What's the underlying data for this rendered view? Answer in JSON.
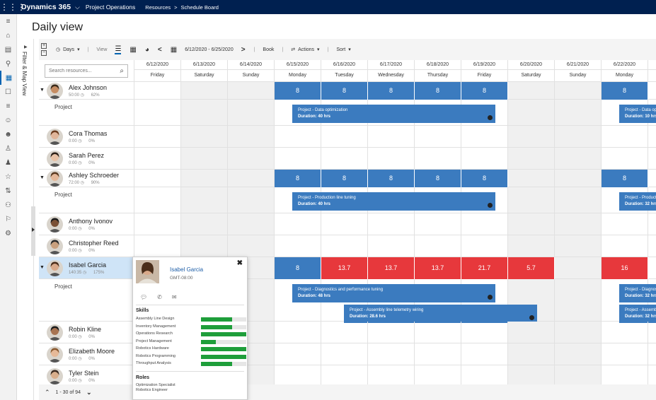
{
  "topbar": {
    "app_name": "Dynamics 365",
    "module": "Project Operations",
    "crumb1": "Resources",
    "crumb2": "Schedule Board"
  },
  "nav_icons": [
    "home-icon",
    "recent-icon",
    "pinned-icon",
    "calendar-icon",
    "chat-icon",
    "list-icon",
    "people-icon",
    "group-icon",
    "person-add-icon",
    "person-icon",
    "star-icon",
    "sort-icon",
    "team-icon",
    "flag-icon",
    "settings-icon"
  ],
  "page": {
    "title": "Daily view"
  },
  "filter": {
    "label": "Filter & Map View"
  },
  "toolbar": {
    "days_label": "Days",
    "view_label": "View",
    "date_range": "6/12/2020 - 6/25/2020",
    "book_label": "Book",
    "actions_label": "Actions",
    "sort_label": "Sort"
  },
  "search": {
    "placeholder": "Search resources..."
  },
  "dates": [
    {
      "date": "6/12/2020",
      "day": "Friday",
      "weekend": false
    },
    {
      "date": "6/13/2020",
      "day": "Saturday",
      "weekend": true
    },
    {
      "date": "6/14/2020",
      "day": "Sunday",
      "weekend": true
    },
    {
      "date": "6/15/2020",
      "day": "Monday",
      "weekend": false
    },
    {
      "date": "6/16/2020",
      "day": "Tuesday",
      "weekend": false
    },
    {
      "date": "6/17/2020",
      "day": "Wednesday",
      "weekend": false
    },
    {
      "date": "6/18/2020",
      "day": "Thursday",
      "weekend": false
    },
    {
      "date": "6/19/2020",
      "day": "Friday",
      "weekend": false
    },
    {
      "date": "6/20/2020",
      "day": "Saturday",
      "weekend": true
    },
    {
      "date": "6/21/2020",
      "day": "Sunday",
      "weekend": true
    },
    {
      "date": "6/22/2020",
      "day": "Monday",
      "weekend": false
    },
    {
      "date": "",
      "day": "",
      "weekend": false
    }
  ],
  "resources": [
    {
      "name": "Alex Johnson",
      "hours": "50:00",
      "pct": "62%",
      "expanded": true,
      "selected": false,
      "skin": "#c58c62",
      "hair": "#3a2a1a",
      "project_label": "Project",
      "capacity": [
        null,
        null,
        null,
        {
          "v": "8",
          "c": "blue"
        },
        {
          "v": "8",
          "c": "blue"
        },
        {
          "v": "8",
          "c": "blue"
        },
        {
          "v": "8",
          "c": "blue"
        },
        {
          "v": "8",
          "c": "blue"
        },
        null,
        null,
        {
          "v": "8",
          "c": "blue"
        }
      ],
      "bookings": [
        {
          "lines": [
            "Project - Data optimization",
            "Duration: 40 hrs"
          ],
          "sub": 0
        }
      ],
      "bookings_right": [
        {
          "lines": [
            "Project - Data optimization",
            "Duration: 10 hrs"
          ],
          "sub": 0
        }
      ]
    },
    {
      "name": "Cora Thomas",
      "hours": "0:00",
      "pct": "0%",
      "expanded": false,
      "selected": false,
      "skin": "#e0b59a",
      "hair": "#6b3b1e"
    },
    {
      "name": "Sarah Perez",
      "hours": "0:00",
      "pct": "0%",
      "expanded": false,
      "selected": false,
      "skin": "#e8c2a6",
      "hair": "#2c2118"
    },
    {
      "name": "Ashley Schroeder",
      "hours": "72:00",
      "pct": "90%",
      "expanded": true,
      "selected": false,
      "skin": "#e4b899",
      "hair": "#5a3a20",
      "project_label": "Project",
      "capacity": [
        null,
        null,
        null,
        {
          "v": "8",
          "c": "blue"
        },
        {
          "v": "8",
          "c": "blue"
        },
        {
          "v": "8",
          "c": "blue"
        },
        {
          "v": "8",
          "c": "blue"
        },
        {
          "v": "8",
          "c": "blue"
        },
        null,
        null,
        {
          "v": "8",
          "c": "blue"
        }
      ],
      "bookings": [
        {
          "lines": [
            "Project - Production line tuning",
            "Duration: 40 hrs"
          ],
          "sub": 0
        }
      ],
      "bookings_right": [
        {
          "lines": [
            "Project - Production line tuning",
            "Duration: 32 hrs"
          ],
          "sub": 0
        }
      ]
    },
    {
      "name": "Anthony Ivonov",
      "hours": "0:00",
      "pct": "0%",
      "expanded": false,
      "selected": false,
      "skin": "#7a5035",
      "hair": "#1a1a1a"
    },
    {
      "name": "Christopher Reed",
      "hours": "0:00",
      "pct": "0%",
      "expanded": false,
      "selected": false,
      "skin": "#c9a07e",
      "hair": "#2a2a2a"
    },
    {
      "name": "Isabel Garcia",
      "hours": "140:35",
      "pct": "175%",
      "expanded": true,
      "selected": true,
      "skin": "#d9a98a",
      "hair": "#4a2d1a",
      "project_label": "Project",
      "capacity": [
        null,
        null,
        null,
        {
          "v": "8",
          "c": "blue"
        },
        {
          "v": "13.7",
          "c": "red"
        },
        {
          "v": "13.7",
          "c": "red"
        },
        {
          "v": "13.7",
          "c": "red"
        },
        {
          "v": "21.7",
          "c": "red"
        },
        {
          "v": "5.7",
          "c": "red"
        },
        null,
        {
          "v": "16",
          "c": "red"
        }
      ],
      "bookings": [
        {
          "lines": [
            "Project - Diagnostics and performance tuning",
            "Duration: 48 hrs"
          ],
          "sub": 0
        },
        {
          "lines": [
            "Project - Assembly line telemetry wiring",
            "Duration: 28.6 hrs"
          ],
          "sub": 1
        }
      ],
      "bookings_right": [
        {
          "lines": [
            "Project - Diagnostics and performance tuning",
            "Duration: 32 hrs"
          ],
          "sub": 0
        },
        {
          "lines": [
            "Project - Assembly line telemetry wiring",
            "Duration: 32 hrs"
          ],
          "sub": 1
        }
      ]
    },
    {
      "name": "Robin Kline",
      "hours": "0:00",
      "pct": "0%",
      "expanded": false,
      "selected": false,
      "skin": "#a87452",
      "hair": "#1c1c1c"
    },
    {
      "name": "Elizabeth Moore",
      "hours": "0:00",
      "pct": "0%",
      "expanded": false,
      "selected": false,
      "skin": "#e6b998",
      "hair": "#8a5a30"
    },
    {
      "name": "Tyler Stein",
      "hours": "0:00",
      "pct": "0%",
      "expanded": false,
      "selected": false,
      "skin": "#d8ae8c",
      "hair": "#3a2a20"
    }
  ],
  "popup": {
    "name": "Isabel Garcia",
    "timezone": "GMT-08:00",
    "skills_title": "Skills",
    "roles_title": "Roles",
    "skills": [
      {
        "name": "Assembly Line Design",
        "level": 0.68
      },
      {
        "name": "Inventory Management",
        "level": 0.68
      },
      {
        "name": "Operations Research",
        "level": 1.0
      },
      {
        "name": "Project Management",
        "level": 0.33
      },
      {
        "name": "Robotics Hardware",
        "level": 1.0
      },
      {
        "name": "Robotics Programming",
        "level": 1.0
      },
      {
        "name": "Throughput Analysis",
        "level": 0.68
      }
    ],
    "roles": [
      "Optimization Specialist",
      "Robotics Engineer"
    ]
  },
  "footer": {
    "paging": "1 - 30 of 94"
  }
}
